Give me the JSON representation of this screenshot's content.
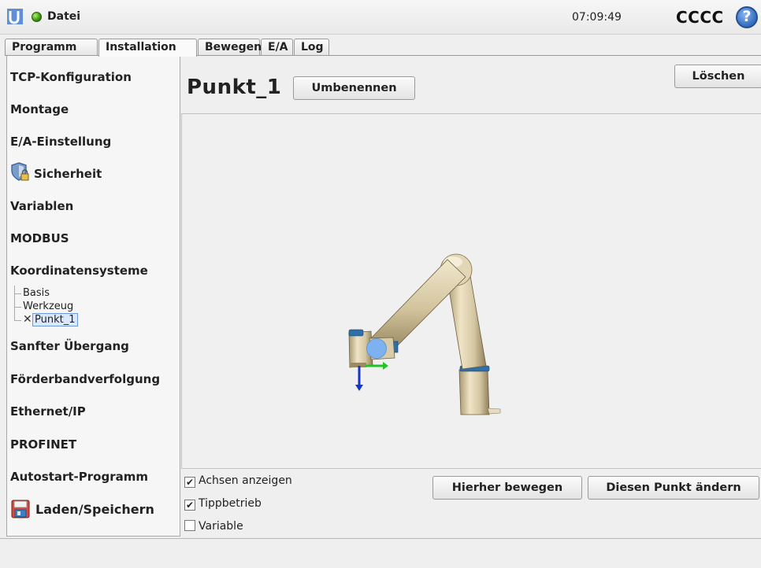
{
  "header": {
    "menu_label": "Datei",
    "time": "07:09:49",
    "robot_name": "CCCC",
    "help_glyph": "?"
  },
  "tabs": [
    {
      "label": "Programm",
      "active": false
    },
    {
      "label": "Installation",
      "active": true
    },
    {
      "label": "Bewegen",
      "active": false
    },
    {
      "label": "E/A",
      "active": false
    },
    {
      "label": "Log",
      "active": false
    }
  ],
  "sidebar": {
    "items": [
      {
        "label": "TCP-Konfiguration"
      },
      {
        "label": "Montage"
      },
      {
        "label": "E/A-Einstellung"
      },
      {
        "label": "Sicherheit",
        "icon": "shield-lock-icon"
      },
      {
        "label": "Variablen"
      },
      {
        "label": "MODBUS"
      },
      {
        "label": "Koordinatensysteme"
      },
      {
        "label": "Sanfter Übergang"
      },
      {
        "label": "Förderbandverfolgung"
      },
      {
        "label": "Ethernet/IP"
      },
      {
        "label": "PROFINET"
      },
      {
        "label": "Autostart-Programm"
      },
      {
        "label": "Laden/Speichern",
        "icon": "floppy-disk-icon"
      }
    ],
    "tree": [
      {
        "label": "Basis",
        "selected": false
      },
      {
        "label": "Werkzeug",
        "selected": false
      },
      {
        "label": "Punkt_1",
        "selected": true
      }
    ]
  },
  "main": {
    "title": "Punkt_1",
    "rename_button": "Umbenennen",
    "delete_button": "Löschen",
    "move_here_button": "Hierher bewegen",
    "change_point_button": "Diesen Punkt ändern",
    "checkboxes": [
      {
        "label": "Achsen anzeigen",
        "checked": true
      },
      {
        "label": "Tippbetrieb",
        "checked": true
      },
      {
        "label": "Variable",
        "checked": false
      }
    ],
    "zoom_icons": [
      "zoom-fit-icon",
      "zoom-in-icon",
      "zoom-out-icon"
    ]
  },
  "colors": {
    "status_led": "#3d9a12",
    "help_blue": "#3a76c8",
    "selection_blue": "#dbe7fb",
    "robot_body": "#d9ccab",
    "robot_ring": "#2f6fa8",
    "axis_x_green": "#22c322",
    "axis_z_blue": "#1836c6",
    "tcp_sphere": "#7eb1f0"
  }
}
